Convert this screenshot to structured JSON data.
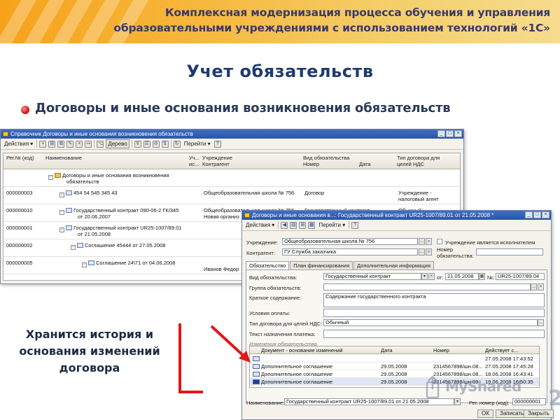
{
  "header": {
    "line1": "Комплексная модернизация процесса обучения и управления",
    "line2": "образовательными учреждениями с использованием технологий «1С»"
  },
  "slide": {
    "title": "Учет обязательств",
    "bullet": "Договоры и иные основания возникновения обязательств",
    "caption_line1": "Хранится история и",
    "caption_line2": "основания изменений",
    "caption_line3": "договора"
  },
  "colors": {
    "accent": "#f7a21b",
    "title": "#1f3b6e",
    "arrow": "#e01818"
  },
  "back_window": {
    "title": "Справочник Договоры и иные основания возникновения обязательств",
    "toolbar": {
      "actions": "Действия",
      "tree": "Дерево",
      "goto": "Перейти"
    },
    "columns": {
      "reg": "Рег.№ (код)",
      "name": "Наименование",
      "uch": "Уч...",
      "is": "ис...",
      "institution": "Учреждение",
      "counterparty": "Контрагент",
      "kind": "Вид обязательства",
      "number": "Номер",
      "date": "Дата",
      "vat": "Тип договора для целей НДС"
    },
    "rows": [
      {
        "reg": "",
        "name1": "Договоры и иные основания возникновения",
        "name2": "обязательств",
        "inst": "",
        "inst2": "",
        "kind": "",
        "vat1": "",
        "vat2": ""
      },
      {
        "reg": "000000003",
        "name1": "454 54 545 345 43",
        "name2": "",
        "inst": "Общеобразовательная школа № 756",
        "inst2": "",
        "kind": "Договор",
        "vat1": "Учреждение -",
        "vat2": "налоговый агент"
      },
      {
        "reg": "000000010",
        "name1": "Государственный контракт 090-06-2 ГК/345",
        "name2": "от 20.06.2007",
        "inst": "Общеобразовательная школа № 756",
        "inst2": "Новая организ",
        "kind": "Государственный контракт",
        "vat1": "Обычный",
        "vat2": ""
      },
      {
        "reg": "000000001",
        "name1": "Государственный контракт UR25-1007/89.01",
        "name2": "от 21.05.2008",
        "inst": "",
        "inst2": "",
        "kind": "",
        "vat1": "",
        "vat2": ""
      },
      {
        "reg": "000000002",
        "name1": "Соглашение 45444 от 27.05.2008",
        "name2": "",
        "inst": "",
        "inst2": "",
        "kind": "",
        "vat1": "",
        "vat2": ""
      },
      {
        "reg": "000000005",
        "name1": "Соглашение 24\\71 от 04.06.2008",
        "name2": "",
        "inst": "",
        "inst2": "Иванов Федор",
        "kind": "",
        "vat1": "",
        "vat2": ""
      }
    ]
  },
  "front_window": {
    "title": "Договоры и иные основания в...: Государственный контракт UR25-1007/89.01 от 21.05.2008 *",
    "toolbar": {
      "actions": "Действия",
      "goto": "Перейти"
    },
    "institution_label": "Учреждение:",
    "institution_value": "Общеобразовательная школа № 756",
    "executor_label": "Учреждение является исполнителем",
    "counterparty_label": "Контрагент:",
    "counterparty_value": "ГУ Служба заказчика",
    "number_label1": "Номер",
    "number_label2": "обязательства:",
    "tabs": [
      "Обязательство",
      "План финансирования",
      "Дополнительная информация"
    ],
    "kind_label": "Вид обязательства:",
    "kind_value": "Государственный контракт",
    "from_label": "от:",
    "from_value": "21.05.2008",
    "no_label": "№:",
    "no_value": "UR25-1007/89.04",
    "group_label": "Группа обязательств:",
    "short_label": "Краткое содержание:",
    "short_value": "Содержание государственного контракта",
    "pay_label": "Условия оплаты:",
    "vat_label": "Тип договора для целей НДС:",
    "vat_value": "Обычный",
    "purpose_label": "Текст назначения платежа:",
    "changes_label": "Изменения обязательства",
    "changes_cols": {
      "doc": "Документ - основание изменений",
      "date": "Дата",
      "num": "Номер",
      "valid": "Действует с..."
    },
    "changes_rows": [
      {
        "doc": "",
        "date": "",
        "num": "",
        "valid": "27.05.2008 17:43:52"
      },
      {
        "doc": "Дополнительное соглашение",
        "date": "29.05.2008",
        "num": "2314567898/шн.08...",
        "valid": "27.05.2008 17:45:28"
      },
      {
        "doc": "Дополнительное соглашение",
        "date": "29.05.2008",
        "num": "2314567898/шн.08...",
        "valid": "18.06.2008 16:43:41"
      },
      {
        "doc": "Дополнительное соглашение",
        "date": "29.05.2008",
        "num": "2314567898/шн.09",
        "valid": "19.06.2008 16:50:35"
      }
    ],
    "name_label": "Наименование:",
    "name_value": "Государственный контракт UR25-1007/89.01 от 21.05.2008",
    "reg_label": "Рег. номер (код):",
    "reg_value": "000000001",
    "buttons": {
      "ok": "ОК",
      "save": "Записать",
      "close": "Закрыть"
    }
  },
  "watermark": {
    "text": "MyShared",
    "corner": "2"
  }
}
